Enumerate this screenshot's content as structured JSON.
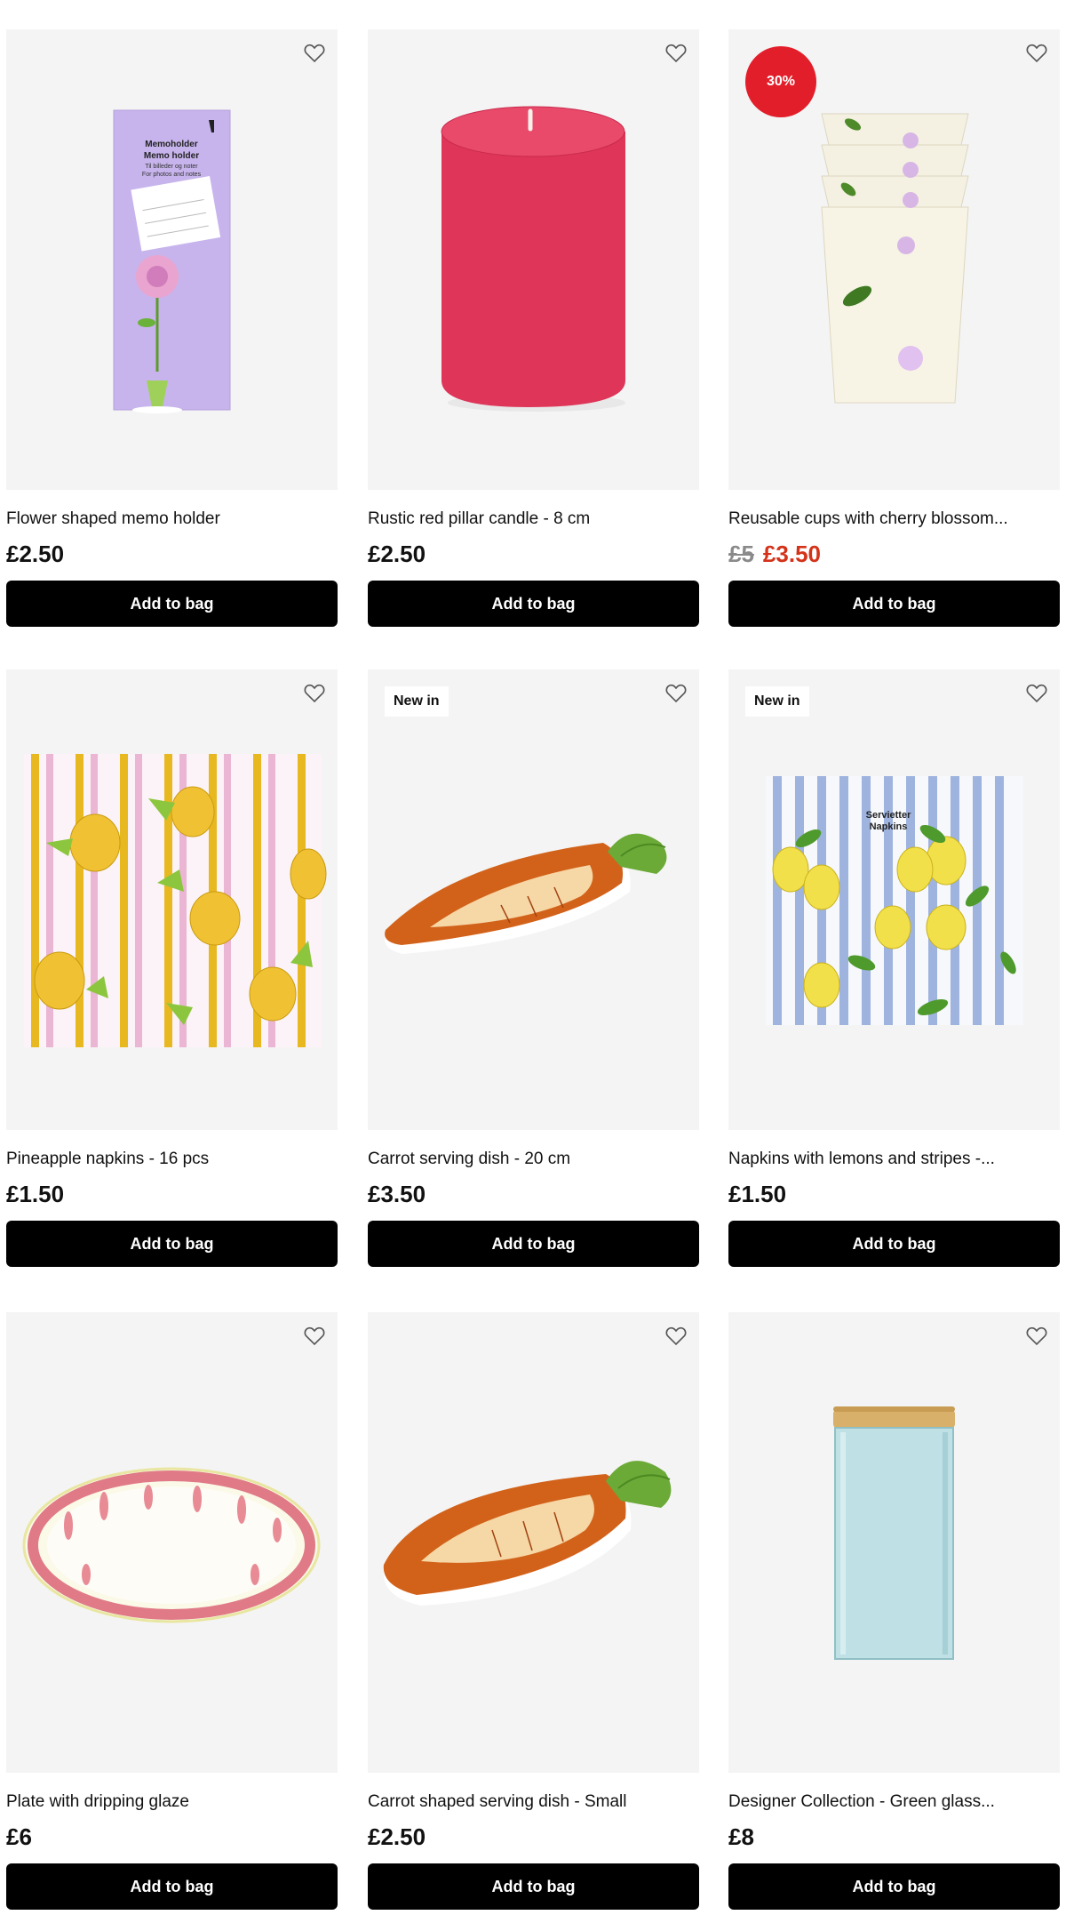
{
  "products": [
    {
      "name": "Flower shaped memo holder",
      "price": "£2.50",
      "button": "Add to bag",
      "icon": "heart-outline-icon",
      "packaging_text": [
        "Memoholder",
        "Memo holder",
        "Til billeder og noter",
        "For photos and notes"
      ]
    },
    {
      "name": "Rustic red pillar candle - 8 cm",
      "price": "£2.50",
      "button": "Add to bag",
      "icon": "heart-outline-icon"
    },
    {
      "name": "Reusable cups with cherry blossom...",
      "old_price": "£5",
      "price": "£3.50",
      "badge": "30%",
      "button": "Add to bag",
      "icon": "heart-outline-icon"
    },
    {
      "name": "Pineapple napkins - 16 pcs",
      "price": "£1.50",
      "button": "Add to bag",
      "icon": "heart-outline-icon"
    },
    {
      "name": "Carrot serving dish - 20 cm",
      "price": "£3.50",
      "badge": "New in",
      "button": "Add to bag",
      "icon": "heart-outline-icon"
    },
    {
      "name": "Napkins with lemons and stripes -...",
      "price": "£1.50",
      "badge": "New in",
      "button": "Add to bag",
      "icon": "heart-outline-icon",
      "packaging_text": [
        "Servietter",
        "Napkins"
      ]
    },
    {
      "name": "Plate with dripping glaze",
      "price": "£6",
      "button": "Add to bag",
      "icon": "heart-outline-icon"
    },
    {
      "name": "Carrot shaped serving dish - Small",
      "price": "£2.50",
      "button": "Add to bag",
      "icon": "heart-outline-icon"
    },
    {
      "name": "Designer Collection - Green glass...",
      "price": "£8",
      "button": "Add to bag",
      "icon": "heart-outline-icon"
    }
  ],
  "colors": {
    "button_bg": "#000000",
    "sale_price": "#d4331a",
    "sale_badge": "#e21e2a",
    "image_bg": "#f4f4f4"
  }
}
